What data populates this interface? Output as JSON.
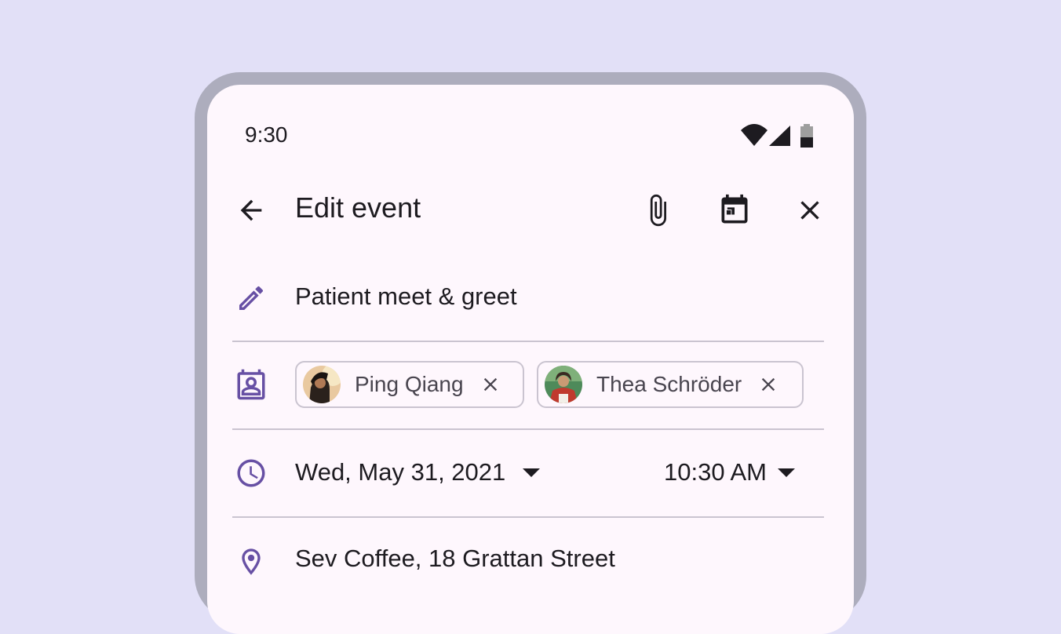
{
  "status_bar": {
    "time": "9:30"
  },
  "app_bar": {
    "title": "Edit event",
    "icons": [
      "arrow-back-icon",
      "attachment-icon",
      "calendar-icon",
      "close-icon"
    ]
  },
  "event": {
    "title": "Patient meet & greet",
    "attendees": [
      {
        "name": "Ping Qiang"
      },
      {
        "name": "Thea Schröder"
      }
    ],
    "date": "Wed, May 31, 2021",
    "time": "10:30 AM",
    "location": "Sev Coffee, 18 Grattan Street"
  },
  "colors": {
    "background": "#e2e0f7",
    "surface": "#fef7fd",
    "frame": "#adadbd",
    "primary_icon": "#6750a4",
    "divider": "#cac4d0"
  }
}
